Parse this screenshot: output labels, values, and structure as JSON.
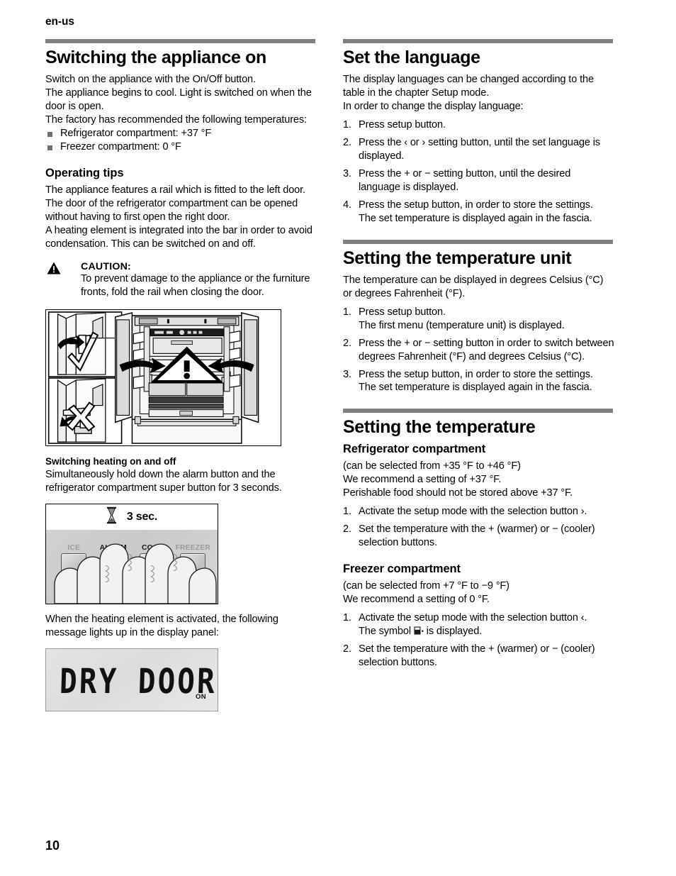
{
  "header": {
    "running_head": "en-us"
  },
  "footer": {
    "page_number": "10"
  },
  "left_column": {
    "section1": {
      "title": "Switching the appliance on",
      "paragraphs": [
        "Switch on the appliance with the On/Off button.",
        "The appliance begins to cool. Light is switched on when the door is open.",
        "The factory has recommended the following temperatures:"
      ],
      "bullets": [
        "Refrigerator compartment:  +37 °F",
        "Freezer compartment:  0 °F"
      ]
    },
    "section2": {
      "title": "Operating tips",
      "paragraphs": [
        "The appliance features a rail which is fitted to the left door.",
        "The door of the refrigerator compartment can be opened without having to first open the right door.",
        "A heating element is integrated into the bar in order to avoid condensation. This can be switched on and off."
      ],
      "caution": {
        "heading": "CAUTION:",
        "text": "To prevent damage to the appliance or the furniture fronts, fold the rail when closing the door."
      },
      "figure_fridge": {
        "icon": "refrigerator-doors-illustration",
        "alt_marks": [
          "check-mark",
          "cross-mark",
          "warning-triangle"
        ]
      }
    },
    "section3": {
      "title": "Switching heating on and off",
      "paragraphs": [
        "Simultaneously hold down the alarm button and the refrigerator compartment super button for 3 seconds."
      ],
      "figure_panel": {
        "timer_label": "3 sec.",
        "timer_icon": "hourglass-icon",
        "buttons": [
          {
            "label": "ICE",
            "active": false
          },
          {
            "label": "ALARM",
            "active": true
          },
          {
            "label": "COOL",
            "active": true
          },
          {
            "label": "FREEZER",
            "active": false
          }
        ]
      },
      "after_text": "When the heating element is activated, the following message lights up in the display panel:",
      "figure_lcd": {
        "display_text": "DRY DOOR",
        "indicator": "ON"
      }
    }
  },
  "right_column": {
    "section1": {
      "title": "Set the language",
      "paragraphs": [
        "The display languages can be changed according to the table in the chapter Setup mode.",
        "In order to change the display language:"
      ],
      "steps": [
        {
          "text": "Press setup button."
        },
        {
          "text": "Press the ‹ or › setting button, until the set language is displayed."
        },
        {
          "text": "Press the + or − setting button, until the desired language is displayed."
        },
        {
          "text": "Press the setup button, in order to store the settings.",
          "cont": "The set temperature is displayed again in the fascia."
        }
      ]
    },
    "section2": {
      "title": "Setting the temperature unit",
      "paragraphs": [
        "The temperature can be displayed in degrees Celsius (°C) or degrees Fahrenheit (°F)."
      ],
      "steps": [
        {
          "text": "Press setup button.",
          "cont": "The first menu (temperature unit) is displayed."
        },
        {
          "text": "Press the + or − setting button in order to switch between degrees Fahrenheit (°F) and degrees Celsius (°C)."
        },
        {
          "text": "Press the setup button, in order to store the settings.",
          "cont": "The set temperature is displayed again in the fascia."
        }
      ]
    },
    "section3": {
      "title": "Setting the temperature",
      "refrigerator": {
        "heading": "Refrigerator compartment",
        "paragraphs": [
          "(can be selected from +35 °F to +46 °F)",
          "We recommend a setting of +37 °F.",
          "Perishable food should not be stored above +37 °F."
        ],
        "steps": [
          {
            "text": "Activate the setup mode with the selection button ›."
          },
          {
            "text": "Set the temperature with the + (warmer) or − (cooler) selection buttons."
          }
        ]
      },
      "freezer": {
        "heading": "Freezer compartment",
        "paragraphs": [
          "(can be selected from +7 °F to −9 °F)",
          "We recommend a setting of 0 °F."
        ],
        "steps": [
          {
            "text": "Activate the setup mode with the selection button ‹.",
            "cont_pre": "The symbol ",
            "cont_post": " is displayed.",
            "cont_icon": "freezer-symbol-icon"
          },
          {
            "text": "Set the temperature with the + (warmer) or − (cooler) selection buttons."
          }
        ]
      }
    }
  }
}
